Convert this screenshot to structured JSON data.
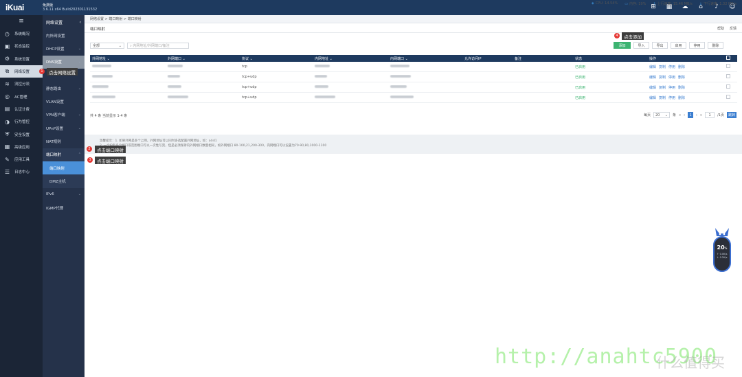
{
  "app": {
    "logo": "iKuai",
    "edition": "免费版",
    "version": "3.6.11 x64 Build202301131532"
  },
  "sidebar": {
    "items": [
      {
        "label": "系统概况",
        "icon": "gauge-icon"
      },
      {
        "label": "状态监控",
        "icon": "monitor-icon"
      },
      {
        "label": "系统设置",
        "icon": "gear-icon"
      },
      {
        "label": "网络设置",
        "icon": "network-icon",
        "active": true
      },
      {
        "label": "流控分流",
        "icon": "flow-icon"
      },
      {
        "label": "AC管理",
        "icon": "ac-icon"
      },
      {
        "label": "认证计费",
        "icon": "auth-icon"
      },
      {
        "label": "行为管控",
        "icon": "behavior-icon"
      },
      {
        "label": "安全设置",
        "icon": "shield-icon"
      },
      {
        "label": "高级应用",
        "icon": "apps-icon"
      },
      {
        "label": "应用工具",
        "icon": "tools-icon"
      },
      {
        "label": "日志中心",
        "icon": "log-icon"
      }
    ]
  },
  "subnav": {
    "title": "网络设置",
    "items": [
      {
        "label": "内外网设置",
        "chev": ""
      },
      {
        "label": "DHCP设置",
        "chev": "⌄"
      },
      {
        "label": "DNS设置",
        "chev": "⌄"
      },
      {
        "label": "",
        "chev": ""
      },
      {
        "label": "静态路由",
        "chev": "⌄"
      },
      {
        "label": "VLAN设置",
        "chev": ""
      },
      {
        "label": "VPN客户端",
        "chev": "⌄"
      },
      {
        "label": "UPnP设置",
        "chev": "⌄"
      },
      {
        "label": "NAT规则",
        "chev": ""
      },
      {
        "label": "端口映射",
        "chev": "⌃"
      },
      {
        "label": "端口映射",
        "chev": ""
      },
      {
        "label": "DMZ主机",
        "chev": ""
      },
      {
        "label": "IPv6",
        "chev": "⌄"
      },
      {
        "label": "IGMP代理",
        "chev": ""
      }
    ]
  },
  "breadcrumb": "网络设置 > 端口映射 > 端口映射",
  "stats": {
    "cpu": "CPU: 14.54%",
    "mem": "内存: 19%",
    "up": "上行速率: 15.46 MB/s",
    "down": "下行速率: 1.32 MB/s"
  },
  "page": {
    "title": "端口映射",
    "help": "帮助",
    "feedback": "反馈"
  },
  "toolbar": {
    "filter_value": "全部",
    "search_placeholder": "内网地址/外网端口/备注",
    "buttons": [
      "添加",
      "导入",
      "导出",
      "启用",
      "停用",
      "删除"
    ]
  },
  "table": {
    "columns": [
      "外网地址",
      "外网端口",
      "协议",
      "内网地址",
      "内网端口",
      "允许访问IP",
      "备注",
      "状态",
      "操作"
    ],
    "rows": [
      {
        "protocol": "tcp",
        "status": "已启用"
      },
      {
        "protocol": "tcp+udp",
        "status": "已启用"
      },
      {
        "protocol": "tcp+udp",
        "status": "已启用"
      },
      {
        "protocol": "tcp+udp",
        "status": "已启用"
      }
    ],
    "ops": [
      "编辑",
      "复制",
      "停用",
      "删除"
    ]
  },
  "pagination": {
    "summary": "共 4 条 当前显示 1-4 条",
    "per_page_label": "每页",
    "per_page": "20",
    "unit": "条",
    "current": "1",
    "jump_value": "1",
    "pages_label": "/1页",
    "go": "跳转"
  },
  "tips": {
    "line1": "温馨提示：1. 如果外网是多个上网，外网地址可以同时多选配置外网地址，如：adsl1",
    "line2": "2. 一个IP有多个端口或范围端口可以一次性写完，但是必须保持内外网端口数量相同，如外网端口 80-100,21,200-300，内网端口可以设置为70-90,80,1000-1100"
  },
  "annotations": [
    {
      "num": "1",
      "text": "点击网络设置"
    },
    {
      "num": "2",
      "text": "点击端口映射"
    },
    {
      "num": "3",
      "text": "点击端口映射"
    },
    {
      "num": "4",
      "text": "点击添加"
    }
  ],
  "widget": {
    "value": "20",
    "unit": "%",
    "up": "0.0K/s",
    "down": "0.2K/s"
  },
  "watermark": {
    "url": "http://anahtc5900",
    "brand": "什么值得买"
  }
}
